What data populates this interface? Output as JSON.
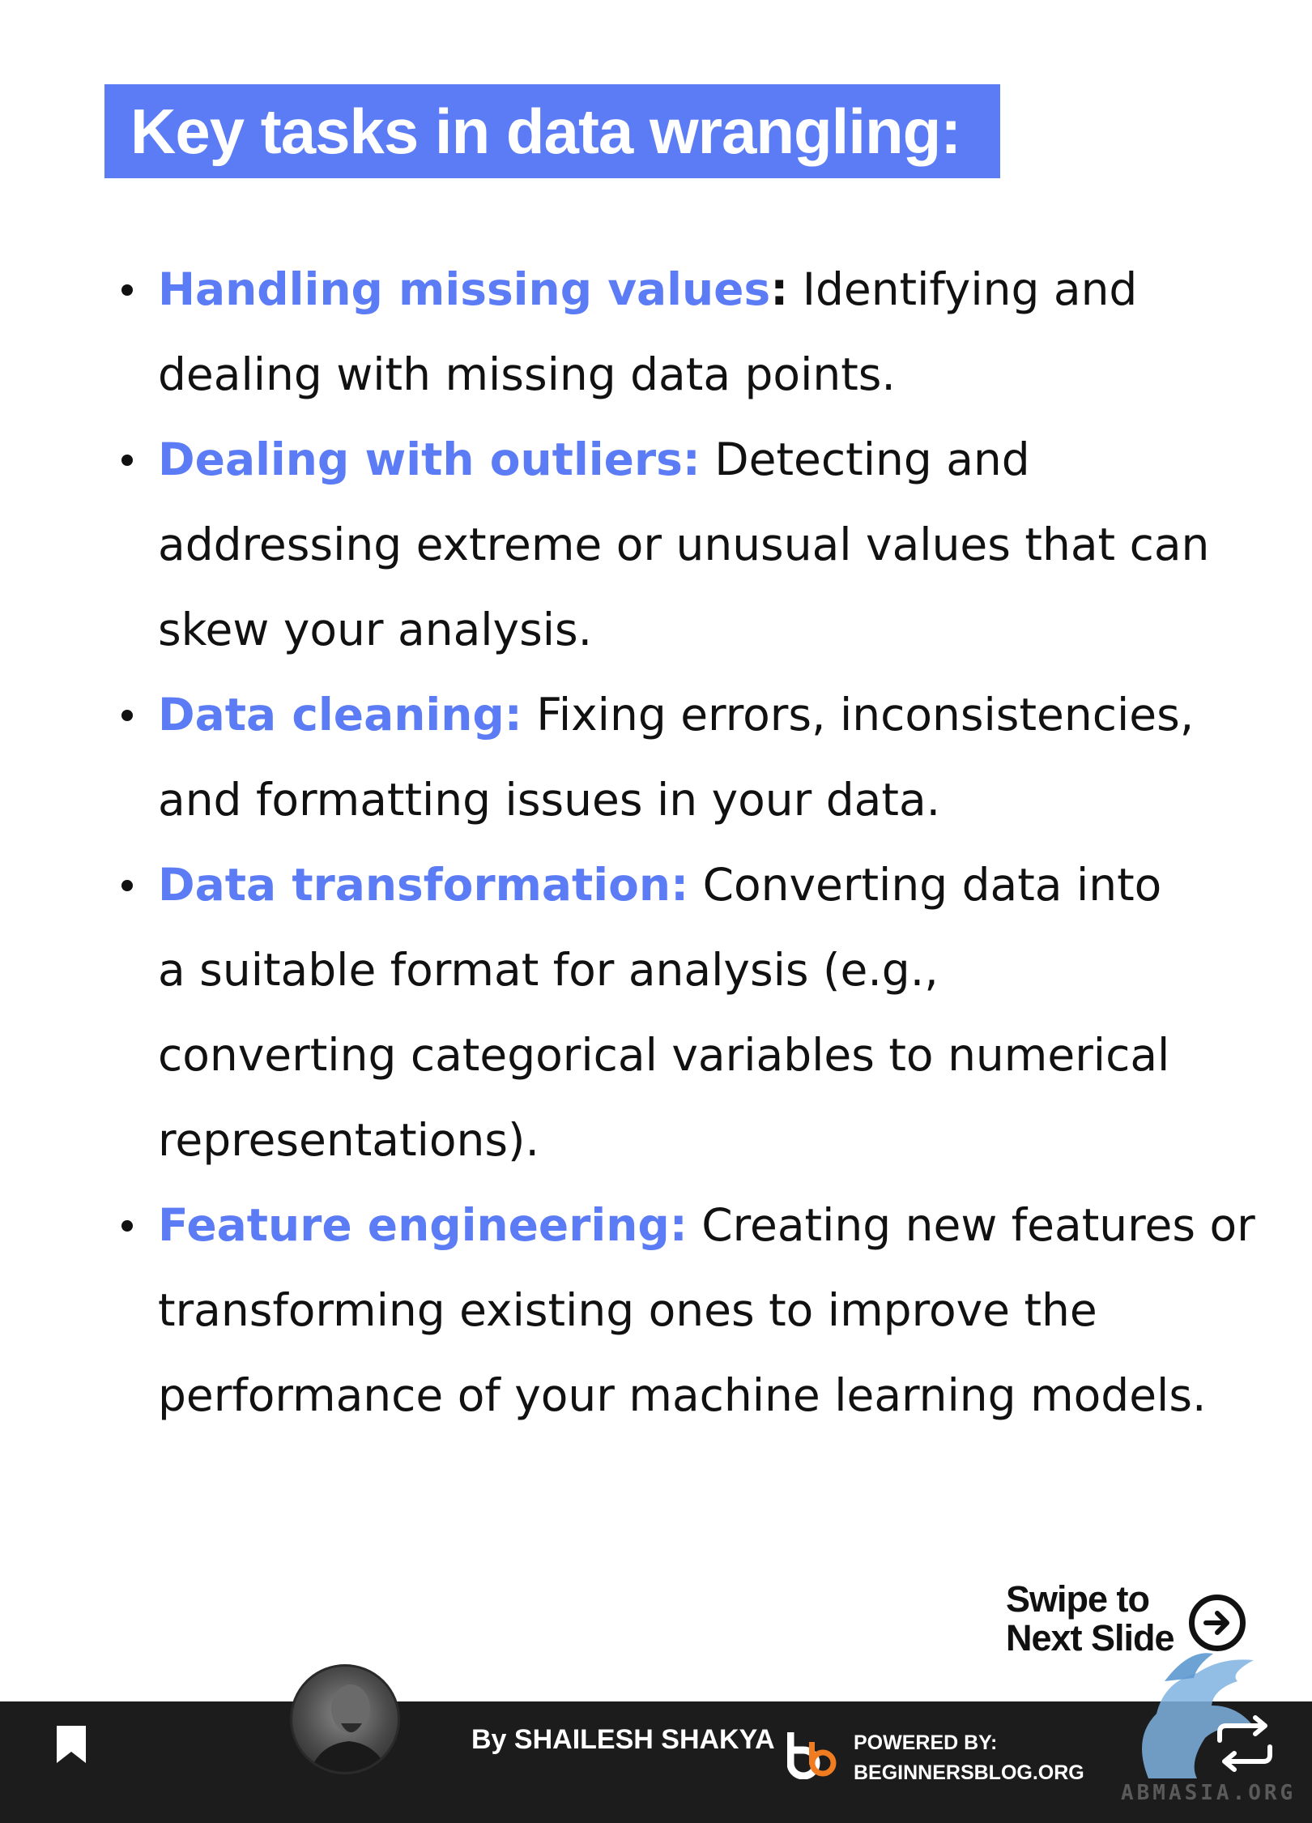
{
  "title": "Key tasks in data wrangling:",
  "bullets": [
    {
      "term": "Handling missing values",
      "colon": ":",
      "text": " Identifying and dealing with missing data points."
    },
    {
      "term": "Dealing with outliers:",
      "colon": "",
      "text": " Detecting and addressing extreme or unusual values that can skew your analysis."
    },
    {
      "term": "Data cleaning:",
      "colon": "",
      "text": " Fixing errors, inconsistencies, and formatting issues in your data."
    },
    {
      "term": "Data transformation:",
      "colon": "",
      "text": " Converting data into a suitable format for analysis (e.g., converting categorical variables to numerical representations)."
    },
    {
      "term": "Feature engineering:",
      "colon": "",
      "text": " Creating new features or transforming existing ones to improve the performance of your machine learning models."
    }
  ],
  "swipe": {
    "line1": "Swipe to",
    "line2": "Next Slide"
  },
  "footer": {
    "byline": "By SHAILESH SHAKYA",
    "powered_label": "POWERED BY:",
    "powered_site": "BEGINNERSBLOG.ORG"
  },
  "watermark": "ABMASIA.ORG",
  "colors": {
    "accent": "#5b7cf5",
    "footer_bg": "#1c1c1c",
    "logo_orange": "#f07c22"
  },
  "icons": [
    "bookmark-icon",
    "arrow-right-circle-icon",
    "repeat-icon",
    "griffin-logo-icon",
    "bb-logo-icon"
  ]
}
